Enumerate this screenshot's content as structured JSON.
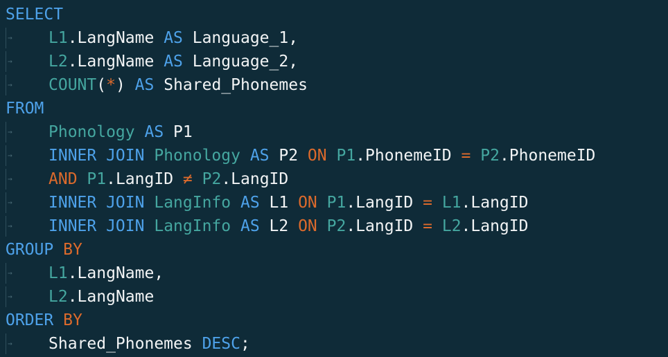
{
  "editor": {
    "colors": {
      "background": "#0f2b38",
      "keyword": "#4ea2ea",
      "operator": "#dc6a2c",
      "table": "#45a7a0",
      "identifier": "#f2f4f5"
    },
    "top_sliver": "'",
    "indent_arrow": "→",
    "lines": [
      {
        "indent": false,
        "tokens": [
          {
            "t": "SELECT",
            "c": "kw"
          }
        ]
      },
      {
        "indent": true,
        "tokens": [
          {
            "t": "L1",
            "c": "tbl"
          },
          {
            "t": ".LangName ",
            "c": "id"
          },
          {
            "t": "AS",
            "c": "kw"
          },
          {
            "t": " Language_1,",
            "c": "id"
          }
        ]
      },
      {
        "indent": true,
        "tokens": [
          {
            "t": "L2",
            "c": "tbl"
          },
          {
            "t": ".LangName ",
            "c": "id"
          },
          {
            "t": "AS",
            "c": "kw"
          },
          {
            "t": " Language_2,",
            "c": "id"
          }
        ]
      },
      {
        "indent": true,
        "tokens": [
          {
            "t": "COUNT",
            "c": "tbl"
          },
          {
            "t": "(",
            "c": "id"
          },
          {
            "t": "*",
            "c": "op"
          },
          {
            "t": ") ",
            "c": "id"
          },
          {
            "t": "AS",
            "c": "kw"
          },
          {
            "t": " Shared_Phonemes",
            "c": "id"
          }
        ]
      },
      {
        "indent": false,
        "tokens": [
          {
            "t": "FROM",
            "c": "kw"
          }
        ]
      },
      {
        "indent": true,
        "tokens": [
          {
            "t": "Phonology",
            "c": "tbl"
          },
          {
            "t": " ",
            "c": "id"
          },
          {
            "t": "AS",
            "c": "kw"
          },
          {
            "t": " P1",
            "c": "id"
          }
        ]
      },
      {
        "indent": true,
        "tokens": [
          {
            "t": "INNER JOIN",
            "c": "kw"
          },
          {
            "t": " ",
            "c": "id"
          },
          {
            "t": "Phonology",
            "c": "tbl"
          },
          {
            "t": " ",
            "c": "id"
          },
          {
            "t": "AS",
            "c": "kw"
          },
          {
            "t": " P2 ",
            "c": "id"
          },
          {
            "t": "ON",
            "c": "op"
          },
          {
            "t": " ",
            "c": "id"
          },
          {
            "t": "P1",
            "c": "tbl"
          },
          {
            "t": ".PhonemeID ",
            "c": "id"
          },
          {
            "t": "=",
            "c": "op"
          },
          {
            "t": " ",
            "c": "id"
          },
          {
            "t": "P2",
            "c": "tbl"
          },
          {
            "t": ".PhonemeID",
            "c": "id"
          }
        ]
      },
      {
        "indent": true,
        "tokens": [
          {
            "t": "AND",
            "c": "op"
          },
          {
            "t": " ",
            "c": "id"
          },
          {
            "t": "P1",
            "c": "tbl"
          },
          {
            "t": ".LangID ",
            "c": "id"
          },
          {
            "t": "≠",
            "c": "op"
          },
          {
            "t": " ",
            "c": "id"
          },
          {
            "t": "P2",
            "c": "tbl"
          },
          {
            "t": ".LangID",
            "c": "id"
          }
        ]
      },
      {
        "indent": true,
        "tokens": [
          {
            "t": "INNER JOIN",
            "c": "kw"
          },
          {
            "t": " ",
            "c": "id"
          },
          {
            "t": "LangInfo",
            "c": "tbl"
          },
          {
            "t": " ",
            "c": "id"
          },
          {
            "t": "AS",
            "c": "kw"
          },
          {
            "t": " L1 ",
            "c": "id"
          },
          {
            "t": "ON",
            "c": "op"
          },
          {
            "t": " ",
            "c": "id"
          },
          {
            "t": "P1",
            "c": "tbl"
          },
          {
            "t": ".LangID ",
            "c": "id"
          },
          {
            "t": "=",
            "c": "op"
          },
          {
            "t": " ",
            "c": "id"
          },
          {
            "t": "L1",
            "c": "tbl"
          },
          {
            "t": ".LangID",
            "c": "id"
          }
        ]
      },
      {
        "indent": true,
        "tokens": [
          {
            "t": "INNER JOIN",
            "c": "kw"
          },
          {
            "t": " ",
            "c": "id"
          },
          {
            "t": "LangInfo",
            "c": "tbl"
          },
          {
            "t": " ",
            "c": "id"
          },
          {
            "t": "AS",
            "c": "kw"
          },
          {
            "t": " L2 ",
            "c": "id"
          },
          {
            "t": "ON",
            "c": "op"
          },
          {
            "t": " ",
            "c": "id"
          },
          {
            "t": "P2",
            "c": "tbl"
          },
          {
            "t": ".LangID ",
            "c": "id"
          },
          {
            "t": "=",
            "c": "op"
          },
          {
            "t": " ",
            "c": "id"
          },
          {
            "t": "L2",
            "c": "tbl"
          },
          {
            "t": ".LangID",
            "c": "id"
          }
        ]
      },
      {
        "indent": false,
        "tokens": [
          {
            "t": "GROUP",
            "c": "kw"
          },
          {
            "t": " ",
            "c": "id"
          },
          {
            "t": "BY",
            "c": "op"
          }
        ]
      },
      {
        "indent": true,
        "tokens": [
          {
            "t": "L1",
            "c": "tbl"
          },
          {
            "t": ".LangName,",
            "c": "id"
          }
        ]
      },
      {
        "indent": true,
        "tokens": [
          {
            "t": "L2",
            "c": "tbl"
          },
          {
            "t": ".LangName",
            "c": "id"
          }
        ]
      },
      {
        "indent": false,
        "tokens": [
          {
            "t": "ORDER",
            "c": "kw"
          },
          {
            "t": " ",
            "c": "id"
          },
          {
            "t": "BY",
            "c": "op"
          }
        ]
      },
      {
        "indent": true,
        "tokens": [
          {
            "t": "Shared_Phonemes ",
            "c": "id"
          },
          {
            "t": "DESC",
            "c": "kw"
          },
          {
            "t": ";",
            "c": "id"
          }
        ]
      }
    ]
  }
}
